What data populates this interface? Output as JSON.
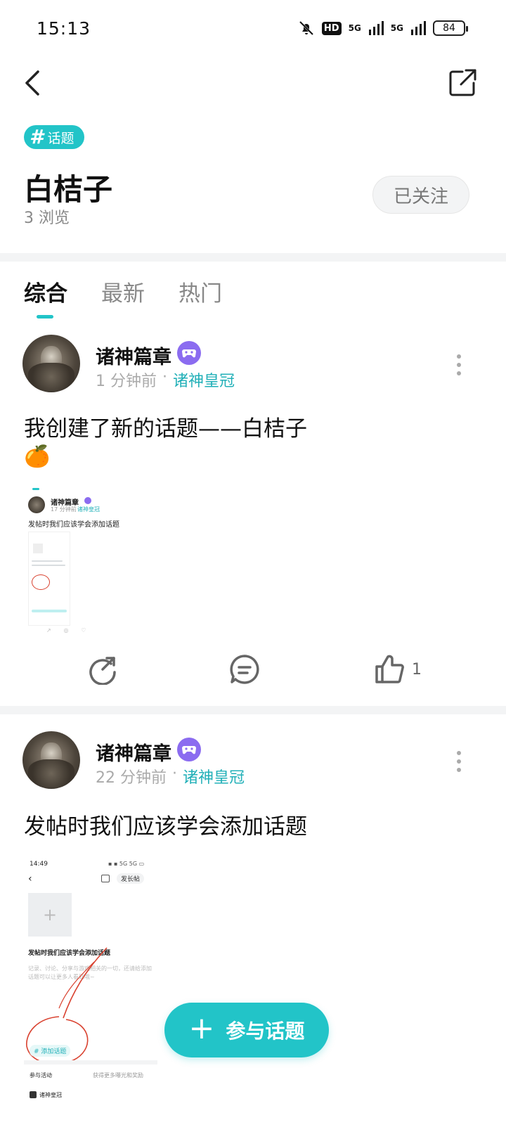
{
  "status_bar": {
    "time": "15:13",
    "hd_label": "HD",
    "signal1": "5G",
    "signal2": "5G",
    "battery": "84"
  },
  "topic": {
    "tag_label": "话题",
    "title": "白桔子",
    "views": "3 浏览",
    "follow_label": "已关注"
  },
  "tabs": [
    {
      "label": "综合",
      "active": true
    },
    {
      "label": "最新",
      "active": false
    },
    {
      "label": "热门",
      "active": false
    }
  ],
  "posts": [
    {
      "author": "诸神篇章",
      "time": "1 分钟前",
      "circle": "诸神皇冠",
      "text": "我创建了新的话题——白桔子",
      "emoji": "🍊",
      "thumbnail": {
        "author": "诸神篇章",
        "time": "17 分钟前",
        "circle": "诸神皇冠",
        "text": "发帖时我们应该学会添加话题"
      },
      "like_count": "1"
    },
    {
      "author": "诸神篇章",
      "time": "22 分钟前",
      "circle": "诸神皇冠",
      "text": "发帖时我们应该学会添加话题",
      "thumbnail": {
        "time": "14:49",
        "long_post_label": "发长帖",
        "title": "发帖时我们应该学会添加话题",
        "placeholder": "记录、讨论、分享与游戏相关的一切，还请给添加话题可以让更多人看到哦~",
        "add_topic_label": "# 添加话题",
        "activity_label": "参与活动",
        "activity_hint": "获得更多曝光和奖励",
        "circle_label": "诸神皇冠"
      }
    }
  ],
  "fab": {
    "label": "参与话题"
  },
  "colors": {
    "accent": "#22c4c8",
    "badge": "#8b6cf0",
    "annotation": "#d9412f"
  }
}
